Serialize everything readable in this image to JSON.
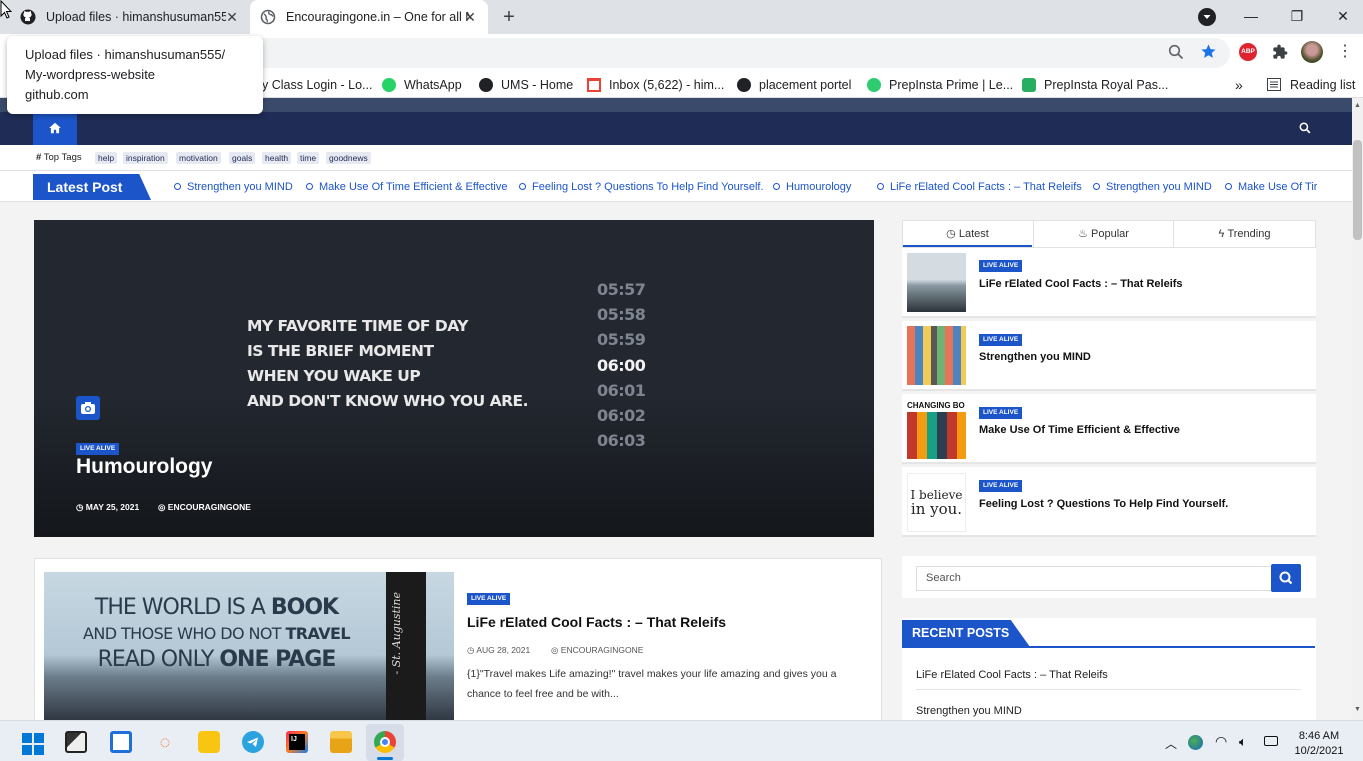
{
  "browser": {
    "tabs": [
      {
        "title": "Upload files · himanshusuman555"
      },
      {
        "title": "Encouragingone.in – One for all N"
      }
    ],
    "tooltip": {
      "title_line1": "Upload files · himanshusuman555/",
      "title_line2": "My-wordpress-website",
      "domain": "github.com"
    },
    "extension_abp": "ABP",
    "bookmarks": [
      {
        "label": "y Class Login - Lo..."
      },
      {
        "label": "WhatsApp"
      },
      {
        "label": "UMS - Home"
      },
      {
        "label": "Inbox (5,622) - him..."
      },
      {
        "label": "placement portel"
      },
      {
        "label": "PrepInsta Prime | Le..."
      },
      {
        "label": "PrepInsta Royal Pas..."
      }
    ],
    "bookmarks_overflow": "»",
    "reading_list": "Reading list"
  },
  "site": {
    "top_tags_label": "Top Tags",
    "tags": [
      "help",
      "inspiration",
      "motivation",
      "goals",
      "health",
      "time",
      "goodnews"
    ],
    "latest_post_label": "Latest Post",
    "ticker": [
      "Strengthen you MIND",
      "Make Use Of Time Efficient & Effective",
      "Feeling Lost ? Questions To Help Find Yourself.",
      "Humourology",
      "LiFe rElated Cool Facts : – That Releifs",
      "Strengthen you MIND",
      "Make Use Of Tir"
    ],
    "featured": {
      "quote_lines": [
        "MY FAVORITE TIME OF DAY",
        "IS THE BRIEF MOMENT",
        "WHEN YOU WAKE UP",
        "AND DON'T KNOW WHO YOU ARE."
      ],
      "clock_times": [
        "05:57",
        "05:58",
        "05:59",
        "06:00",
        "06:01",
        "06:02",
        "06:03"
      ],
      "category": "LIVE ALIVE",
      "title": "Humourology",
      "date": "MAY 25, 2021",
      "author": "ENCOURAGINGONE"
    },
    "card": {
      "image_text": {
        "line1a": "THE WORLD IS A ",
        "line1b": "BOOK",
        "line2a": "AND THOSE WHO DO NOT ",
        "line2b": "TRAVEL",
        "line3a": "READ ONLY ",
        "line3b": "ONE PAGE",
        "signature": "- St. Augustine"
      },
      "category": "LIVE ALIVE",
      "title": "LiFe rElated Cool Facts : – That Releifs",
      "date": "AUG 28, 2021",
      "author": "ENCOURAGINGONE",
      "excerpt_line1": "{1}\"Travel makes Life amazing!\" travel makes your life amazing and gives you a",
      "excerpt_line2": "chance to feel free and be with..."
    },
    "sidebar": {
      "tabs": [
        "Latest",
        "Popular",
        "Trending"
      ],
      "items": [
        {
          "category": "LIVE ALIVE",
          "title": "LiFe rElated Cool Facts : – That Releifs"
        },
        {
          "category": "LIVE ALIVE",
          "title": "Strengthen you MIND"
        },
        {
          "category": "LIVE ALIVE",
          "title": "Make Use Of Time Efficient & Effective",
          "thumb_text": "CHANGING BO"
        },
        {
          "category": "LIVE ALIVE",
          "title": "Feeling Lost ? Questions To Help Find Yourself.",
          "thumb_text_1": "I believe",
          "thumb_text_2": "in you."
        }
      ],
      "search_placeholder": "Search",
      "recent_posts_label": "RECENT POSTS",
      "recent_posts": [
        "LiFe rElated Cool Facts : – That Releifs",
        "Strengthen you MIND"
      ]
    }
  },
  "taskbar": {
    "time": "8:46 AM",
    "date": "10/2/2021"
  },
  "colors": {
    "accent": "#1c55c9",
    "nav": "#1f2c56"
  }
}
